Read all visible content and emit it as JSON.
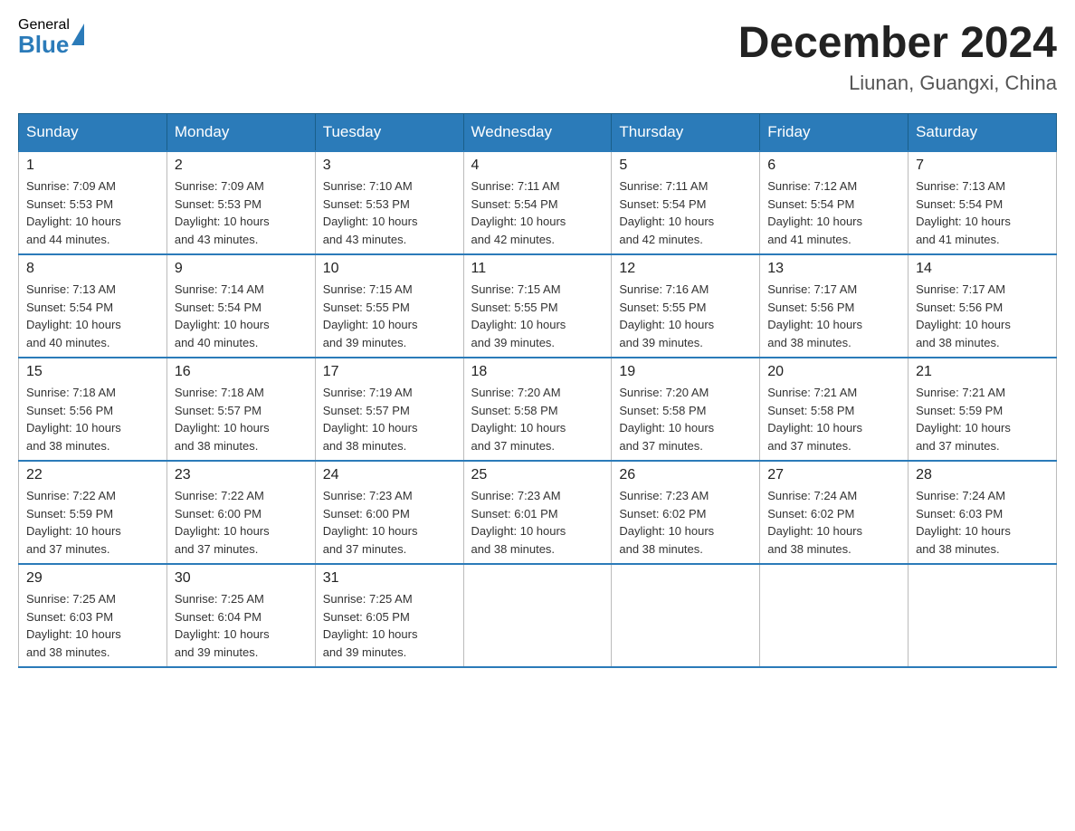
{
  "header": {
    "logo_general": "General",
    "logo_blue": "Blue",
    "month_title": "December 2024",
    "location": "Liunan, Guangxi, China"
  },
  "weekdays": [
    "Sunday",
    "Monday",
    "Tuesday",
    "Wednesday",
    "Thursday",
    "Friday",
    "Saturday"
  ],
  "weeks": [
    [
      {
        "day": "1",
        "sunrise": "7:09 AM",
        "sunset": "5:53 PM",
        "daylight": "10 hours and 44 minutes."
      },
      {
        "day": "2",
        "sunrise": "7:09 AM",
        "sunset": "5:53 PM",
        "daylight": "10 hours and 43 minutes."
      },
      {
        "day": "3",
        "sunrise": "7:10 AM",
        "sunset": "5:53 PM",
        "daylight": "10 hours and 43 minutes."
      },
      {
        "day": "4",
        "sunrise": "7:11 AM",
        "sunset": "5:54 PM",
        "daylight": "10 hours and 42 minutes."
      },
      {
        "day": "5",
        "sunrise": "7:11 AM",
        "sunset": "5:54 PM",
        "daylight": "10 hours and 42 minutes."
      },
      {
        "day": "6",
        "sunrise": "7:12 AM",
        "sunset": "5:54 PM",
        "daylight": "10 hours and 41 minutes."
      },
      {
        "day": "7",
        "sunrise": "7:13 AM",
        "sunset": "5:54 PM",
        "daylight": "10 hours and 41 minutes."
      }
    ],
    [
      {
        "day": "8",
        "sunrise": "7:13 AM",
        "sunset": "5:54 PM",
        "daylight": "10 hours and 40 minutes."
      },
      {
        "day": "9",
        "sunrise": "7:14 AM",
        "sunset": "5:54 PM",
        "daylight": "10 hours and 40 minutes."
      },
      {
        "day": "10",
        "sunrise": "7:15 AM",
        "sunset": "5:55 PM",
        "daylight": "10 hours and 39 minutes."
      },
      {
        "day": "11",
        "sunrise": "7:15 AM",
        "sunset": "5:55 PM",
        "daylight": "10 hours and 39 minutes."
      },
      {
        "day": "12",
        "sunrise": "7:16 AM",
        "sunset": "5:55 PM",
        "daylight": "10 hours and 39 minutes."
      },
      {
        "day": "13",
        "sunrise": "7:17 AM",
        "sunset": "5:56 PM",
        "daylight": "10 hours and 38 minutes."
      },
      {
        "day": "14",
        "sunrise": "7:17 AM",
        "sunset": "5:56 PM",
        "daylight": "10 hours and 38 minutes."
      }
    ],
    [
      {
        "day": "15",
        "sunrise": "7:18 AM",
        "sunset": "5:56 PM",
        "daylight": "10 hours and 38 minutes."
      },
      {
        "day": "16",
        "sunrise": "7:18 AM",
        "sunset": "5:57 PM",
        "daylight": "10 hours and 38 minutes."
      },
      {
        "day": "17",
        "sunrise": "7:19 AM",
        "sunset": "5:57 PM",
        "daylight": "10 hours and 38 minutes."
      },
      {
        "day": "18",
        "sunrise": "7:20 AM",
        "sunset": "5:58 PM",
        "daylight": "10 hours and 37 minutes."
      },
      {
        "day": "19",
        "sunrise": "7:20 AM",
        "sunset": "5:58 PM",
        "daylight": "10 hours and 37 minutes."
      },
      {
        "day": "20",
        "sunrise": "7:21 AM",
        "sunset": "5:58 PM",
        "daylight": "10 hours and 37 minutes."
      },
      {
        "day": "21",
        "sunrise": "7:21 AM",
        "sunset": "5:59 PM",
        "daylight": "10 hours and 37 minutes."
      }
    ],
    [
      {
        "day": "22",
        "sunrise": "7:22 AM",
        "sunset": "5:59 PM",
        "daylight": "10 hours and 37 minutes."
      },
      {
        "day": "23",
        "sunrise": "7:22 AM",
        "sunset": "6:00 PM",
        "daylight": "10 hours and 37 minutes."
      },
      {
        "day": "24",
        "sunrise": "7:23 AM",
        "sunset": "6:00 PM",
        "daylight": "10 hours and 37 minutes."
      },
      {
        "day": "25",
        "sunrise": "7:23 AM",
        "sunset": "6:01 PM",
        "daylight": "10 hours and 38 minutes."
      },
      {
        "day": "26",
        "sunrise": "7:23 AM",
        "sunset": "6:02 PM",
        "daylight": "10 hours and 38 minutes."
      },
      {
        "day": "27",
        "sunrise": "7:24 AM",
        "sunset": "6:02 PM",
        "daylight": "10 hours and 38 minutes."
      },
      {
        "day": "28",
        "sunrise": "7:24 AM",
        "sunset": "6:03 PM",
        "daylight": "10 hours and 38 minutes."
      }
    ],
    [
      {
        "day": "29",
        "sunrise": "7:25 AM",
        "sunset": "6:03 PM",
        "daylight": "10 hours and 38 minutes."
      },
      {
        "day": "30",
        "sunrise": "7:25 AM",
        "sunset": "6:04 PM",
        "daylight": "10 hours and 39 minutes."
      },
      {
        "day": "31",
        "sunrise": "7:25 AM",
        "sunset": "6:05 PM",
        "daylight": "10 hours and 39 minutes."
      },
      null,
      null,
      null,
      null
    ]
  ],
  "labels": {
    "sunrise": "Sunrise:",
    "sunset": "Sunset:",
    "daylight": "Daylight:"
  }
}
